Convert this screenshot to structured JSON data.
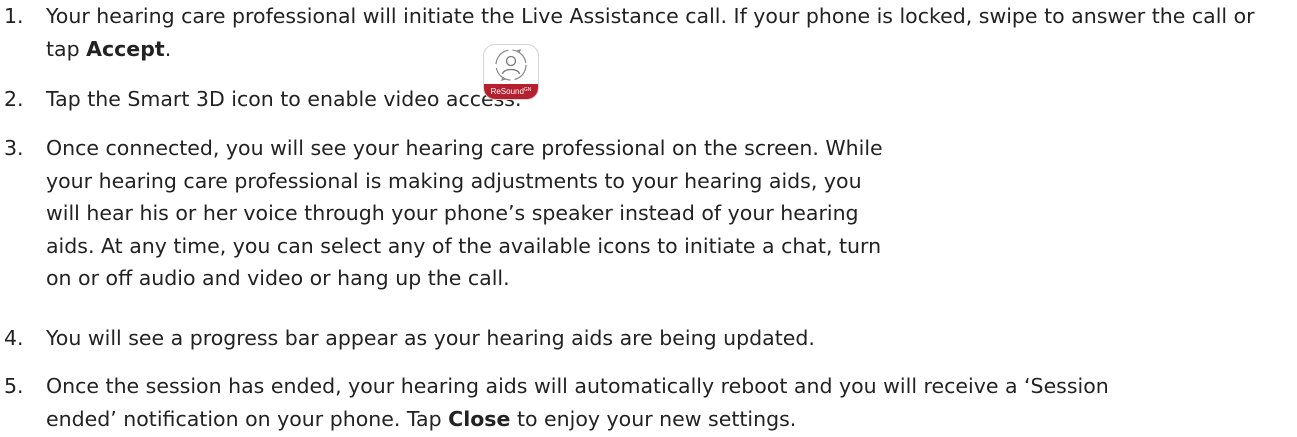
{
  "steps": [
    {
      "number": "1.",
      "text_before": "Your hearing care professional will initiate the Live Assistance call. If your phone is locked, swipe to answer the call or tap ",
      "emphasis": "Accept",
      "text_after": "."
    },
    {
      "number": "2.",
      "text": "Tap the Smart 3D icon to enable video access."
    },
    {
      "number": "3.",
      "text": "Once connected, you will see your hearing care professional on the screen. While your hearing care professional is making adjustments to your hearing aids, you will hear his or her voice through your phone’s speaker instead of your hearing aids. At any time, you can select any of the available icons to initiate a chat, turn on or off audio and video or hang up the call."
    },
    {
      "number": "4.",
      "text": "You will see a progress bar appear as your hearing aids are being updated."
    },
    {
      "number": "5.",
      "text_before": "Once the session has ended, your hearing aids will automatically reboot and you will receive a ‘Session ended’ notification on your phone. Tap ",
      "emphasis": "Close",
      "text_after": " to enjoy your new settings."
    }
  ],
  "app_icon": {
    "icon": "smart-3d-app-icon",
    "brand": "ReSound",
    "brand_super": "GN",
    "brand_color": "#b51f2e"
  }
}
